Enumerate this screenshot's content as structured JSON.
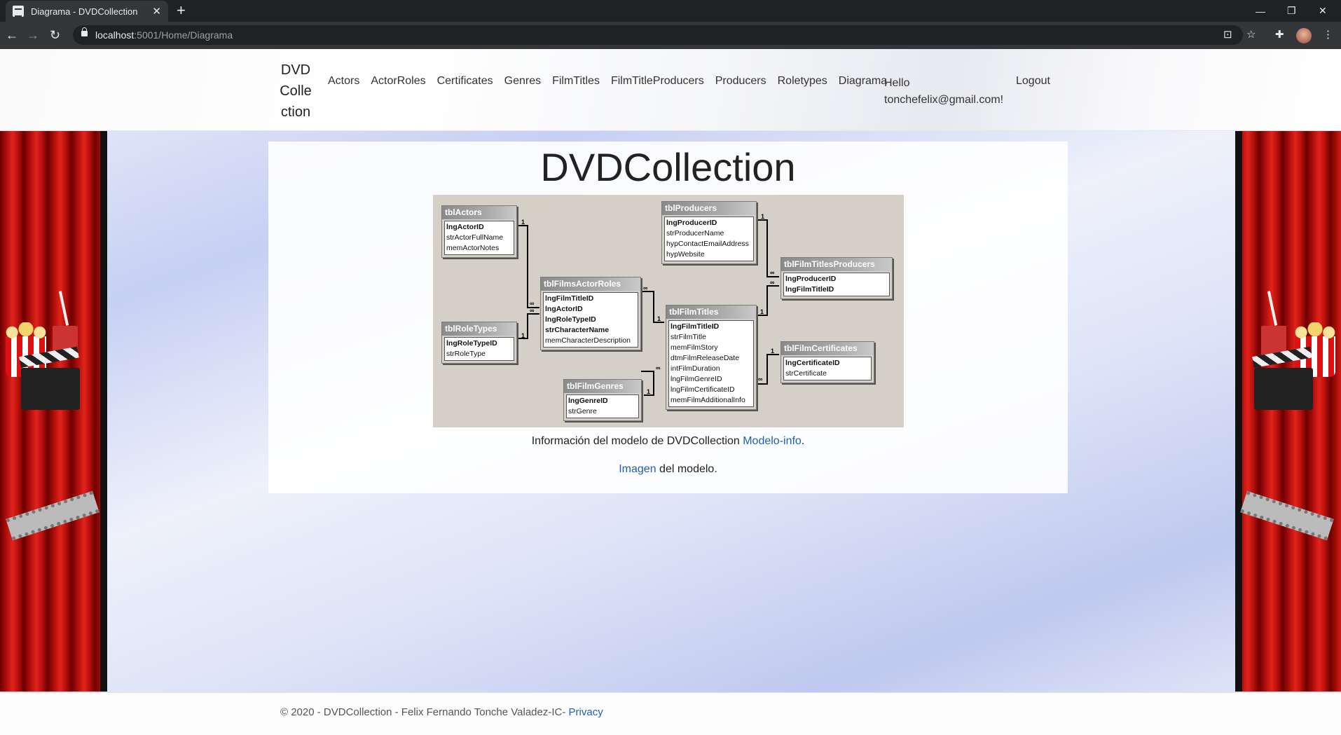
{
  "browser": {
    "tab_title": "Diagrama - DVDCollection",
    "url_host": "localhost",
    "url_path": ":5001/Home/Diagrama"
  },
  "nav": {
    "brand": "DVD Colle ction",
    "links": [
      "Actors",
      "ActorRoles",
      "Certificates",
      "Genres",
      "FilmTitles",
      "FilmTitleProducers",
      "Producers",
      "Roletypes",
      "Diagrama"
    ],
    "hello": "Hello tonchefelix@gmail.com!",
    "logout": "Logout"
  },
  "main": {
    "title": "DVDCollection",
    "info_text": "Información del modelo de DVDCollection",
    "info_link": "Modelo-info",
    "info_end": ".",
    "image_link": "Imagen",
    "image_text": " del modelo."
  },
  "diagram": {
    "tables": [
      {
        "name": "tblActors",
        "fields": [
          {
            "n": "lngActorID",
            "k": true
          },
          {
            "n": "strActorFullName",
            "k": false
          },
          {
            "n": "memActorNotes",
            "k": false
          }
        ]
      },
      {
        "name": "tblRoleTypes",
        "fields": [
          {
            "n": "lngRoleTypeID",
            "k": true
          },
          {
            "n": "strRoleType",
            "k": false
          }
        ]
      },
      {
        "name": "tblFilmsActorRoles",
        "fields": [
          {
            "n": "lngFilmTitleID",
            "k": true
          },
          {
            "n": "lngActorID",
            "k": true
          },
          {
            "n": "lngRoleTypeID",
            "k": true
          },
          {
            "n": "strCharacterName",
            "k": true
          },
          {
            "n": "memCharacterDescription",
            "k": false
          }
        ]
      },
      {
        "name": "tblProducers",
        "fields": [
          {
            "n": "lngProducerID",
            "k": true
          },
          {
            "n": "strProducerName",
            "k": false
          },
          {
            "n": "hypContactEmailAddress",
            "k": false
          },
          {
            "n": "hypWebsite",
            "k": false
          }
        ]
      },
      {
        "name": "tblFilmTitlesProducers",
        "fields": [
          {
            "n": "lngProducerID",
            "k": true
          },
          {
            "n": "lngFilmTitleID",
            "k": true
          }
        ]
      },
      {
        "name": "tblFilmTitles",
        "fields": [
          {
            "n": "lngFilmTitleID",
            "k": true
          },
          {
            "n": "strFilmTitle",
            "k": false
          },
          {
            "n": "memFilmStory",
            "k": false
          },
          {
            "n": "dtmFilmReleaseDate",
            "k": false
          },
          {
            "n": "intFilmDuration",
            "k": false
          },
          {
            "n": "lngFilmGenreID",
            "k": false
          },
          {
            "n": "lngFilmCertificateID",
            "k": false
          },
          {
            "n": "memFilmAdditionalInfo",
            "k": false
          }
        ]
      },
      {
        "name": "tblFilmGenres",
        "fields": [
          {
            "n": "lngGenreID",
            "k": true
          },
          {
            "n": "strGenre",
            "k": false
          }
        ]
      },
      {
        "name": "tblFilmCertificates",
        "fields": [
          {
            "n": "lngCertificateID",
            "k": true
          },
          {
            "n": "strCertificate",
            "k": false
          }
        ]
      }
    ],
    "one_label": "1",
    "many_label": "∞"
  },
  "footer": {
    "text": "© 2020 - DVDCollection - Felix Fernando Tonche Valadez-IC- ",
    "privacy": "Privacy"
  }
}
